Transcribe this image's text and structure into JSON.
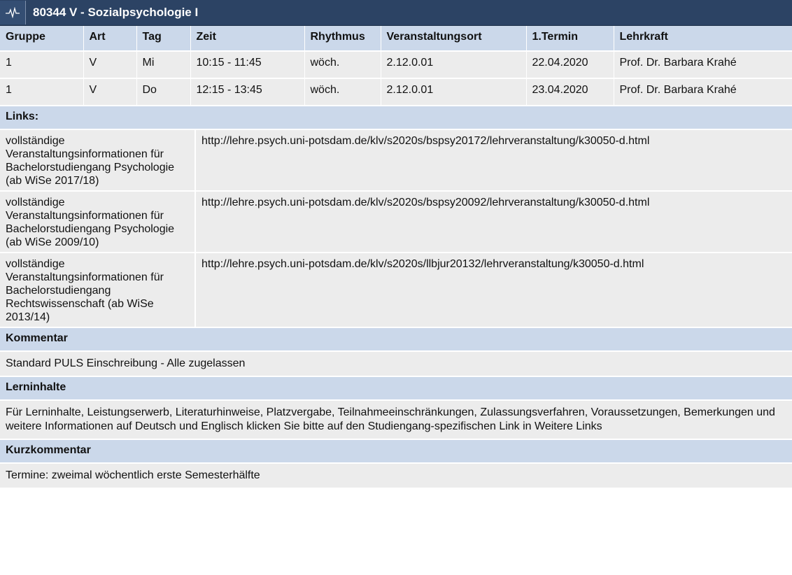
{
  "header": {
    "title": "80344 V - Sozialpsychologie I",
    "icon": "pulse-icon"
  },
  "schedule": {
    "columns": [
      "Gruppe",
      "Art",
      "Tag",
      "Zeit",
      "Rhythmus",
      "Veranstaltungsort",
      "1.Termin",
      "Lehrkraft"
    ],
    "rows": [
      [
        "1",
        "V",
        "Mi",
        "10:15 - 11:45",
        "wöch.",
        "2.12.0.01",
        "22.04.2020",
        "Prof. Dr. Barbara Krahé"
      ],
      [
        "1",
        "V",
        "Do",
        "12:15 - 13:45",
        "wöch.",
        "2.12.0.01",
        "23.04.2020",
        "Prof. Dr. Barbara Krahé"
      ]
    ]
  },
  "links": {
    "heading": "Links:",
    "items": [
      {
        "desc": "vollständige Veranstaltungsinformationen für Bachelorstudiengang Psychologie (ab WiSe 2017/18)",
        "url": "http://lehre.psych.uni-potsdam.de/klv/s2020s/bspsy20172/lehrveranstaltung/k30050-d.html"
      },
      {
        "desc": "vollständige Veranstaltungsinformationen für Bachelorstudiengang Psychologie (ab WiSe 2009/10)",
        "url": "http://lehre.psych.uni-potsdam.de/klv/s2020s/bspsy20092/lehrveranstaltung/k30050-d.html"
      },
      {
        "desc": "vollständige Veranstaltungsinformationen für Bachelorstudiengang Rechtswissenschaft (ab WiSe 2013/14)",
        "url": "http://lehre.psych.uni-potsdam.de/klv/s2020s/llbjur20132/lehrveranstaltung/k30050-d.html"
      }
    ]
  },
  "kommentar": {
    "heading": "Kommentar",
    "text": "Standard PULS Einschreibung - Alle zugelassen"
  },
  "lerninhalte": {
    "heading": "Lerninhalte",
    "text": "Für Lerninhalte, Leistungserwerb, Literaturhinweise, Platzvergabe, Teilnahmeeinschränkungen, Zulassungsverfahren, Voraussetzungen, Bemerkungen und weitere Informationen auf Deutsch und Englisch klicken Sie bitte auf den Studiengang-spezifischen Link in Weitere Links"
  },
  "kurzkommentar": {
    "heading": "Kurzkommentar",
    "text": "Termine: zweimal wöchentlich erste Semesterhälfte"
  },
  "colors": {
    "header_bg": "#2c4364",
    "section_bg": "#cbd8ea",
    "row_bg": "#ececec"
  }
}
